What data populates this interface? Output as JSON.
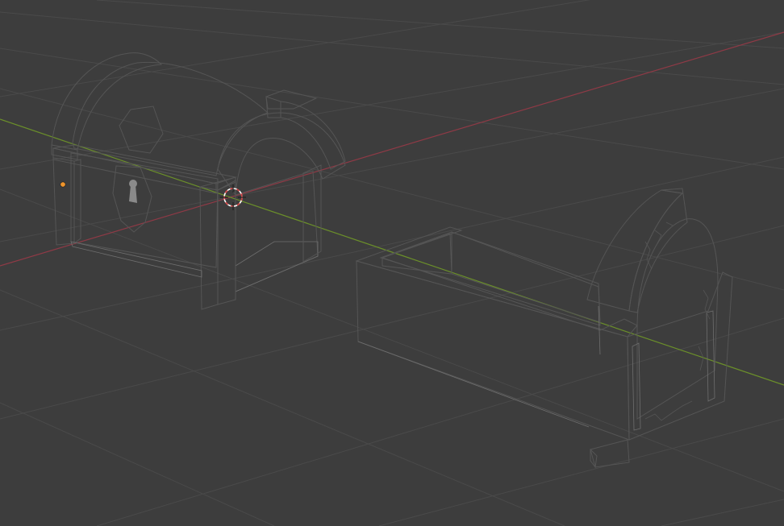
{
  "colors": {
    "background": "#3d3d3d",
    "grid_line": "#4a4a4a",
    "x_axis": "#8f3a46",
    "y_axis": "#6b8f2a",
    "mesh_light": "#b4b4b4",
    "mesh_mid": "#a3a3a3",
    "mesh_dark": "#8e8e8e",
    "origin_point": "#f0952c",
    "cursor_red": "#d44040",
    "cursor_white": "#ffffff"
  },
  "objects": [
    {
      "name": "chest-lid",
      "type": "mesh",
      "selected": false
    },
    {
      "name": "chest-base",
      "type": "mesh",
      "selected": false
    }
  ],
  "icons": [
    "3d-cursor-icon",
    "object-origin-icon"
  ]
}
